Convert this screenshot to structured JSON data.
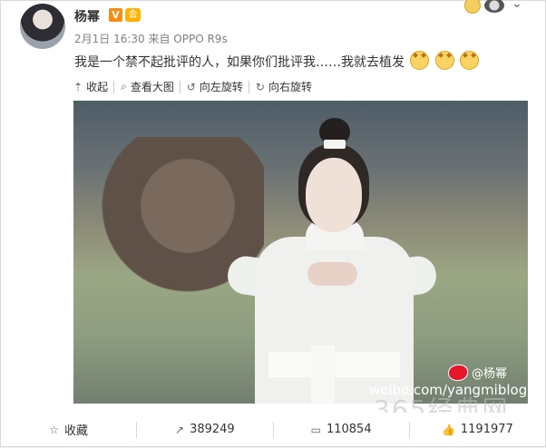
{
  "post": {
    "username": "杨幂",
    "badges": {
      "v": "V",
      "vip": "会"
    },
    "meta": "2月1日 16:30 来自 OPPO R9s",
    "content": "我是一个禁不起批评的人，如果你们批评我……我就去植发",
    "toolbar": {
      "collapse": "收起",
      "view_large": "查看大图",
      "rotate_left": "向左旋转",
      "rotate_right": "向右旋转"
    },
    "image": {
      "watermark_user": "@杨幂",
      "watermark_url": "weibo.com/yangmiblog"
    },
    "footer": {
      "favorite": "收藏",
      "repost": "389249",
      "comment": "110854",
      "like": "1191977"
    },
    "faint_watermark": "365经典网"
  },
  "icons": [
    "up-arrow-icon",
    "search-icon",
    "rotate-left-icon",
    "rotate-right-icon",
    "favorite-icon",
    "repost-icon",
    "comment-icon",
    "like-icon"
  ]
}
